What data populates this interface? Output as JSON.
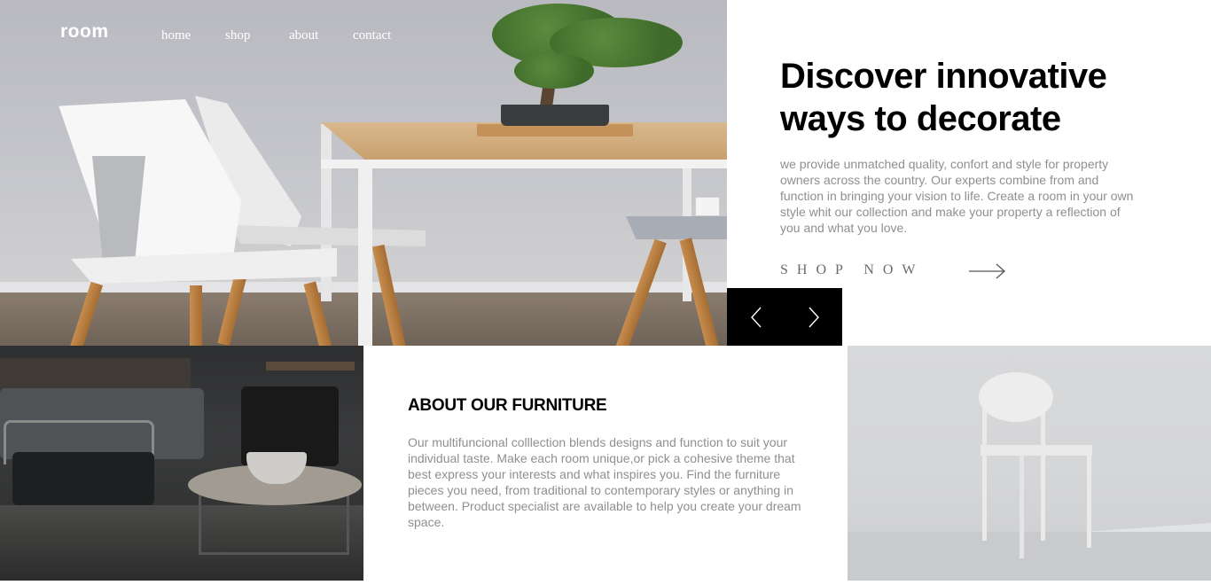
{
  "brand": {
    "logo": "room"
  },
  "nav": {
    "items": [
      {
        "label": "home"
      },
      {
        "label": "shop"
      },
      {
        "label": "about"
      },
      {
        "label": "contact"
      }
    ]
  },
  "hero": {
    "title": "Discover innovative ways to decorate",
    "description": "we provide unmatched quality, confort and style for property owners across the country. Our experts combine from and function in bringing your vision to life. Create a room in your own style whit our collection and make your property a reflection of you and what you love.",
    "cta_label": "SHOP NOW",
    "cta_icon": "arrow-right-icon"
  },
  "slider": {
    "prev_icon": "chevron-left-icon",
    "next_icon": "chevron-right-icon"
  },
  "about": {
    "title": "ABOUT OUR FURNITURE",
    "description": "Our multifuncional colllection blends designs and function to suit your individual taste. Make each room unique,or pick a cohesive theme that best express your interests and what inspires you. Find the furniture pieces you need, from traditional to contemporary styles or anything in between. Product specialist are available to help you create your dream space."
  },
  "colors": {
    "title_text": "#000000",
    "body_text": "#8f8f8f",
    "slider_bg": "#000000",
    "nav_text": "#ffffff"
  }
}
